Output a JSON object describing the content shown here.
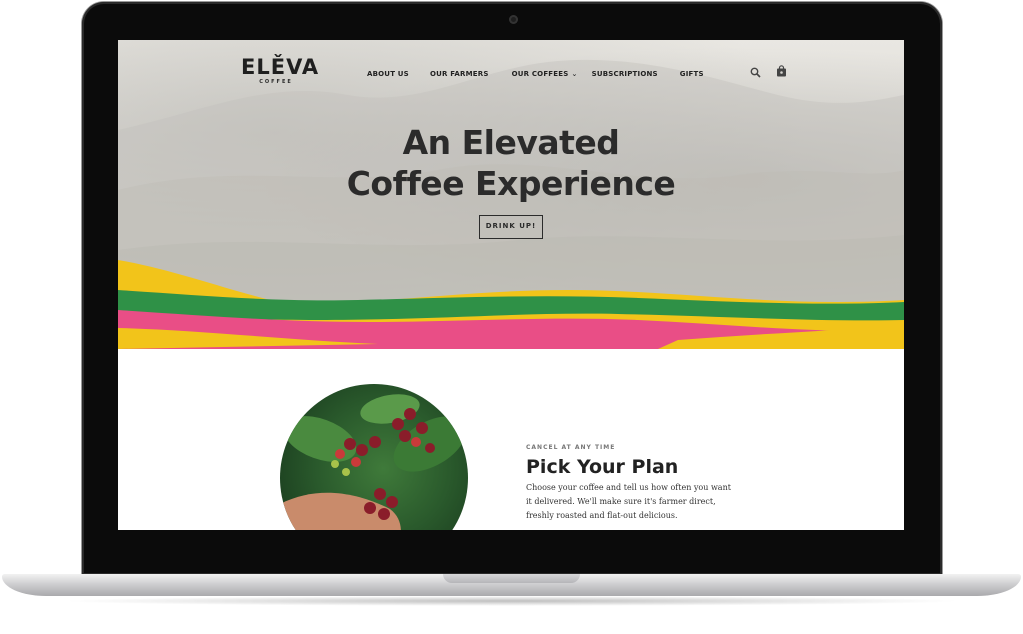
{
  "site": {
    "logo_word": "ELĚVA",
    "logo_sub": "COFFEE"
  },
  "nav": {
    "items": [
      {
        "label": "ABOUT US"
      },
      {
        "label": "OUR FARMERS"
      },
      {
        "label": "OUR COFFEES"
      },
      {
        "label": "SUBSCRIPTIONS"
      },
      {
        "label": "GIFTS"
      }
    ],
    "icons": [
      "search-icon",
      "shopping-bag-icon"
    ]
  },
  "hero": {
    "title_line1": "An Elevated",
    "title_line2": "Coffee Experience",
    "cta_label": "DRINK UP!"
  },
  "plan": {
    "eyebrow": "CANCEL AT ANY TIME",
    "title": "Pick Your Plan",
    "body": "Choose your coffee and tell us how often you want it delivered. We'll make sure it's farmer direct, freshly roasted and flat-out delicious."
  },
  "colors": {
    "brand_yellow": "#f2c41a",
    "brand_green": "#2f9147",
    "brand_pink": "#e94e86",
    "text_dark": "#222222"
  }
}
